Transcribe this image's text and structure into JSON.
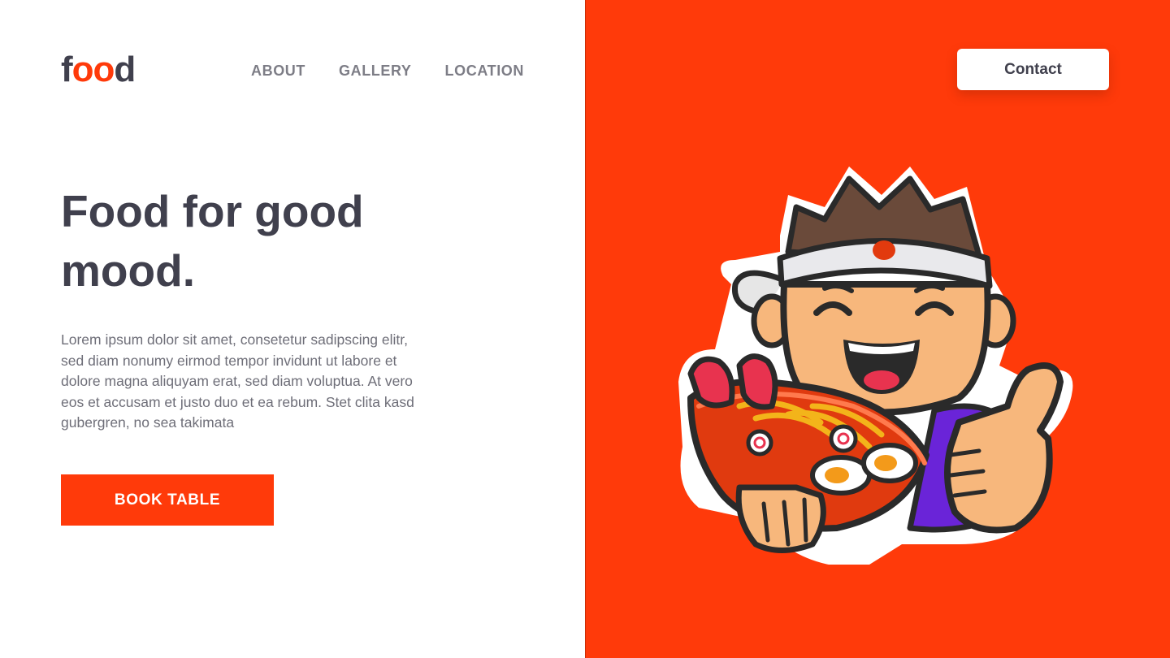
{
  "brand": {
    "logo_f": "f",
    "logo_oo": "oo",
    "logo_d": "d"
  },
  "nav": {
    "items": [
      {
        "label": "ABOUT"
      },
      {
        "label": "GALLERY"
      },
      {
        "label": "LOCATION"
      }
    ]
  },
  "hero": {
    "title": "Food for good mood.",
    "body": "Lorem ipsum dolor sit amet, consetetur sadipscing elitr, sed diam nonumy eirmod tempor invidunt ut labore et dolore magna aliquyam erat, sed diam voluptua. At vero eos et accusam et justo duo et ea rebum. Stet clita kasd gubergren, no sea takimata",
    "cta_label": "BOOK TABLE"
  },
  "header": {
    "contact_label": "Contact"
  },
  "illustration": {
    "icon": "ramen-chef-mascot-illustration"
  },
  "colors": {
    "accent": "#ff3a0a",
    "text_dark": "#40404d",
    "text_muted": "#6e6e78",
    "nav_text": "#7d7d86"
  }
}
